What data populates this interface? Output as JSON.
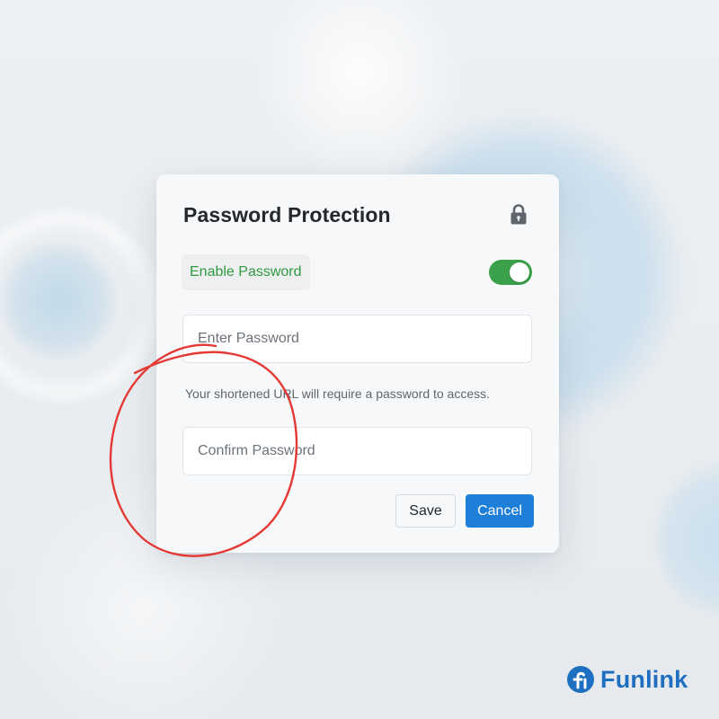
{
  "dialog": {
    "title": "Password Protection",
    "lock_icon": "lock-icon",
    "toggle": {
      "label": "Enable Password",
      "on": true,
      "color": "#3aa14a"
    },
    "password_field": {
      "placeholder": "Enter Password",
      "value": ""
    },
    "helper_text": "Your shortened URL will require a password to access.",
    "confirm_field": {
      "placeholder": "Confirm Password",
      "value": ""
    },
    "buttons": {
      "save_label": "Save",
      "cancel_label": "Cancel",
      "cancel_color": "#1e7fd8"
    }
  },
  "annotation": {
    "type": "hand-drawn-circle",
    "color": "#e53935"
  },
  "brand": {
    "name": "Funlink",
    "logo_icon": "funlink-logo-icon",
    "color": "#1e6fc0"
  }
}
